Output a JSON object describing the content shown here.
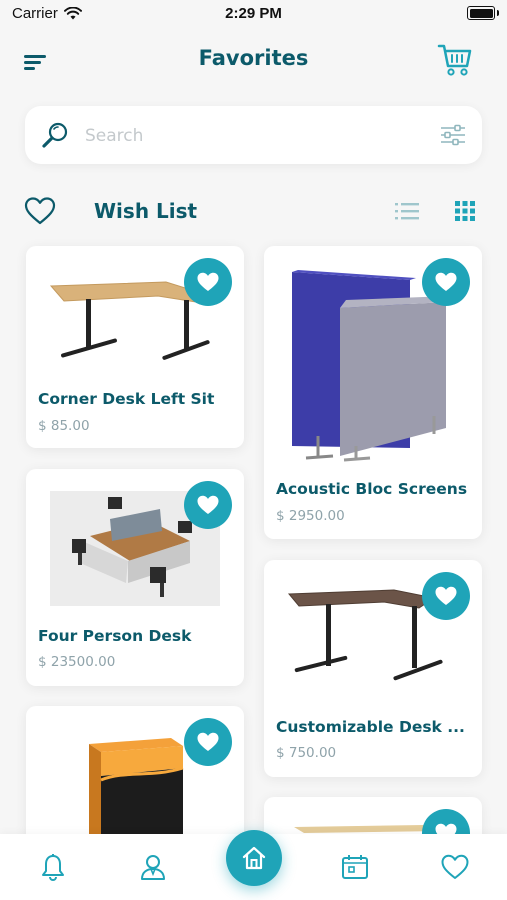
{
  "status_bar": {
    "carrier": "Carrier",
    "time": "2:29 PM"
  },
  "header": {
    "title": "Favorites",
    "menu_icon": "menu-icon",
    "cart_icon": "cart-icon"
  },
  "search": {
    "placeholder": "Search",
    "value": ""
  },
  "wishlist": {
    "title": "Wish List",
    "active_view": "grid"
  },
  "products": [
    {
      "name": "Corner Desk Left Sit",
      "price": "$ 85.00",
      "image": "corner-desk",
      "favorited": true
    },
    {
      "name": "Acoustic Bloc Screens",
      "price": "$ 2950.00",
      "image": "acoustic-screens",
      "favorited": true
    },
    {
      "name": "Four Person Desk",
      "price": "$ 23500.00",
      "image": "four-person-desk",
      "favorited": true
    },
    {
      "name": "Customizable Desk ...",
      "price": "$ 750.00",
      "image": "customizable-desk",
      "favorited": true
    },
    {
      "name": "",
      "price": "",
      "image": "software-box",
      "favorited": true
    },
    {
      "name": "",
      "price": "",
      "image": "desk",
      "favorited": true
    }
  ],
  "bottom_nav": {
    "items": [
      "notifications",
      "profile",
      "home",
      "calendar",
      "favorites"
    ],
    "active": "home"
  },
  "colors": {
    "accent": "#1fa4b8",
    "title": "#0c5a6a",
    "price": "#8fa3aa",
    "background": "#f6f6f6"
  }
}
